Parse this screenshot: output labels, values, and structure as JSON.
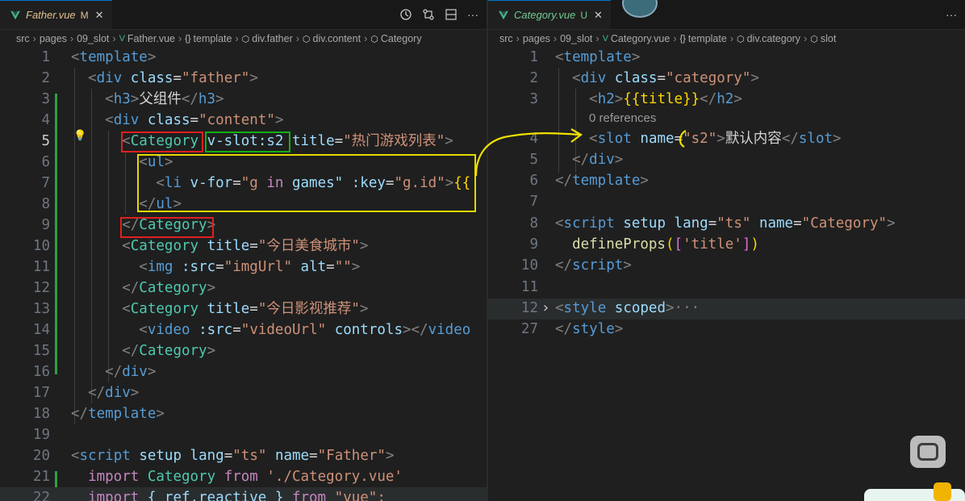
{
  "left": {
    "tab": {
      "name": "Father.vue",
      "badge": "M",
      "close": "✕"
    },
    "breadcrumb": [
      "src",
      "pages",
      "09_slot",
      "Father.vue",
      "template",
      "div.father",
      "div.content",
      "Category"
    ],
    "lines": [
      {
        "n": "1"
      },
      {
        "n": "2"
      },
      {
        "n": "3"
      },
      {
        "n": "4"
      },
      {
        "n": "5"
      },
      {
        "n": "6"
      },
      {
        "n": "7"
      },
      {
        "n": "8"
      },
      {
        "n": "9"
      },
      {
        "n": "10"
      },
      {
        "n": "11"
      },
      {
        "n": "12"
      },
      {
        "n": "13"
      },
      {
        "n": "14"
      },
      {
        "n": "15"
      },
      {
        "n": "16"
      },
      {
        "n": "17"
      },
      {
        "n": "18"
      },
      {
        "n": "19"
      },
      {
        "n": "20"
      },
      {
        "n": "21"
      },
      {
        "n": "22"
      }
    ],
    "code": {
      "l1_tag": "template",
      "l2_tag": "div",
      "l2_attr": "class",
      "l2_val": "\"father\"",
      "l3_tag": "h3",
      "l3_text": "父组件",
      "l4_tag": "div",
      "l4_attr": "class",
      "l4_val": "\"content\"",
      "l5_tag": "Category",
      "l5_dir": "v-slot:s2",
      "l5_attr": "title",
      "l5_val": "\"热门游戏列表\"",
      "l6_tag": "ul",
      "l7_tag": "li",
      "l7_dir": "v-for",
      "l7_val1": "\"g ",
      "l7_in": "in",
      "l7_val2": " games\"",
      "l7_attr": ":key",
      "l7_val3": "\"g.id\"",
      "l7_mus": "{{",
      "l8_tag": "ul",
      "l9_tag": "Category",
      "l10_tag": "Category",
      "l10_attr": "title",
      "l10_val": "\"今日美食城市\"",
      "l11_tag": "img",
      "l11_attr": ":src",
      "l11_val": "\"imgUrl\"",
      "l11_attr2": "alt",
      "l11_val2": "\"\"",
      "l12_tag": "Category",
      "l13_tag": "Category",
      "l13_attr": "title",
      "l13_val": "\"今日影视推荐\"",
      "l14_tag": "video",
      "l14_attr": ":src",
      "l14_val": "\"videoUrl\"",
      "l14_attr2": "controls",
      "l14_close": "video",
      "l15_tag": "Category",
      "l16_tag": "div",
      "l17_tag": "div",
      "l18_tag": "template",
      "l20_tag": "script",
      "l20_attr": "setup",
      "l20_attr2": "lang",
      "l20_val2": "\"ts\"",
      "l20_attr3": "name",
      "l20_val3": "\"Father\"",
      "l21_kw": "import",
      "l21_id": "Category",
      "l21_from": "from",
      "l21_str": "'./Category.vue'",
      "l22_kw": "import",
      "l22_text": " { ref,reactive } ",
      "l22_from": "from",
      "l22_str": "\"vue\";"
    }
  },
  "right": {
    "tab": {
      "name": "Category.vue",
      "badge": "U",
      "close": "✕"
    },
    "breadcrumb": [
      "src",
      "pages",
      "09_slot",
      "Category.vue",
      "template",
      "div.category",
      "slot"
    ],
    "lines": [
      {
        "n": "1"
      },
      {
        "n": "2"
      },
      {
        "n": "3"
      },
      {
        "n": "4"
      },
      {
        "n": "5"
      },
      {
        "n": "6"
      },
      {
        "n": "7"
      },
      {
        "n": "8"
      },
      {
        "n": "9"
      },
      {
        "n": "10"
      },
      {
        "n": "11"
      },
      {
        "n": "12"
      },
      {
        "n": "27"
      }
    ],
    "code": {
      "l1_tag": "template",
      "l2_tag": "div",
      "l2_attr": "class",
      "l2_val": "\"category\"",
      "l3_tag": "h2",
      "l3_must": "{{title}}",
      "codelens": "0 references",
      "l4_tag": "slot",
      "l4_attr": "name",
      "l4_val": "\"s2\"",
      "l4_text": "默认内容",
      "l5_tag": "div",
      "l6_tag": "template",
      "l8_tag": "script",
      "l8_attr": "setup",
      "l8_attr2": "lang",
      "l8_val2": "\"ts\"",
      "l8_attr3": "name",
      "l8_val3": "\"Category\"",
      "l9_fn": "defineProps",
      "l9_arg": "'title'",
      "l10_tag": "script",
      "l12_tag": "style",
      "l12_attr": "scoped",
      "l12_fold": "···",
      "l27_tag": "style"
    }
  }
}
